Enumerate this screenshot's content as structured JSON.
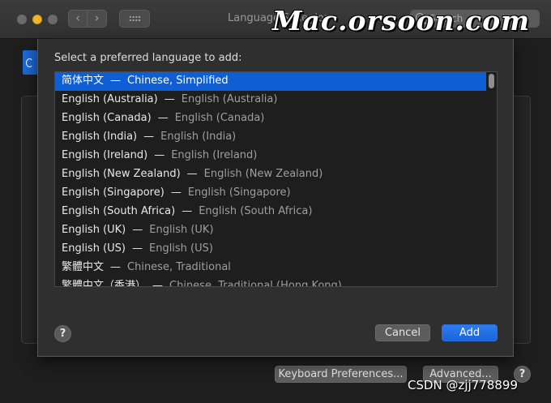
{
  "window": {
    "title": "Language & Region",
    "search_placeholder": "Search"
  },
  "watermark": {
    "text": "Mac.orsoon.com",
    "footer": "CSDN @zjj778899"
  },
  "sheet": {
    "prompt": "Select a preferred language to add:",
    "selected_index": 0,
    "languages": [
      {
        "native": "简体中文",
        "english": "Chinese, Simplified"
      },
      {
        "native": "English (Australia)",
        "english": "English (Australia)"
      },
      {
        "native": "English (Canada)",
        "english": "English (Canada)"
      },
      {
        "native": "English (India)",
        "english": "English (India)"
      },
      {
        "native": "English (Ireland)",
        "english": "English (Ireland)"
      },
      {
        "native": "English (New Zealand)",
        "english": "English (New Zealand)"
      },
      {
        "native": "English (Singapore)",
        "english": "English (Singapore)"
      },
      {
        "native": "English (South Africa)",
        "english": "English (South Africa)"
      },
      {
        "native": "English (UK)",
        "english": "English (UK)"
      },
      {
        "native": "English (US)",
        "english": "English (US)"
      },
      {
        "native": "繁體中文",
        "english": "Chinese, Traditional"
      },
      {
        "native": "繁體中文（香港）",
        "english": "Chinese, Traditional (Hong Kong)"
      }
    ],
    "separator": "—",
    "help_label": "?",
    "cancel_label": "Cancel",
    "add_label": "Add"
  },
  "pane": {
    "keyboard_label": "Keyboard Preferences...",
    "advanced_label": "Advanced...",
    "help_label": "?"
  },
  "colors": {
    "accent": "#0f5ed4",
    "add_button": "#1a64d8",
    "minimize": "#f0b72c"
  },
  "icons": {
    "back": "chevron-left-icon",
    "forward": "chevron-right-icon",
    "grid": "grid-icon",
    "search": "search-icon",
    "pane": "flag-icon"
  }
}
